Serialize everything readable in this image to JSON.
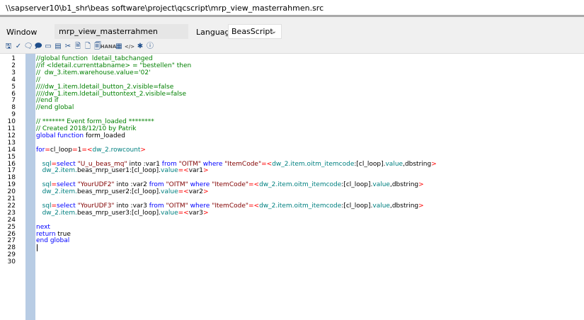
{
  "titlebar": {
    "path": "\\\\sapserver10\\b1_shr\\beas software\\project\\qcscript\\mrp_view_masterrahmen.src"
  },
  "form": {
    "window_label": "Window",
    "window_value": "mrp_view_masterrahmen",
    "language_label": "Language",
    "language_value": "BeasScript"
  },
  "toolbar": [
    {
      "icon": "save-icon",
      "glyph": "🖫"
    },
    {
      "icon": "check-syntax-icon",
      "glyph": "✓"
    },
    {
      "icon": "comment-icon",
      "glyph": "🗨"
    },
    {
      "icon": "uncomment-icon",
      "glyph": "🗩"
    },
    {
      "icon": "message-icon",
      "glyph": "▭"
    },
    {
      "icon": "format-icon",
      "glyph": "▤"
    },
    {
      "icon": "tools-icon",
      "glyph": "✂"
    },
    {
      "icon": "document-icon",
      "glyph": "🗎"
    },
    {
      "icon": "document-alt-icon",
      "glyph": "🗋"
    },
    {
      "icon": "document-list-icon",
      "glyph": "🗐"
    },
    {
      "icon": "hana-icon",
      "glyph": "HANA"
    },
    {
      "icon": "database-icon",
      "glyph": "▦"
    },
    {
      "icon": "code-icon",
      "glyph": "</>"
    },
    {
      "icon": "debug-icon",
      "glyph": "✱"
    },
    {
      "icon": "info-icon",
      "glyph": "ⓘ"
    }
  ],
  "line_numbers": [
    "1",
    "2",
    "3",
    "4",
    "5",
    "6",
    "7",
    "8",
    "9",
    "10",
    "11",
    "12",
    "13",
    "14",
    "15",
    "16",
    "17",
    "18",
    "19",
    "20",
    "21",
    "22",
    "23",
    "24",
    "25",
    "26",
    "27",
    "28",
    "29",
    "30"
  ],
  "code_lines": [
    [
      {
        "c": "cm",
        "t": "//global function  ldetail_tabchanged"
      }
    ],
    [
      {
        "c": "cm",
        "t": "//if <ldetail.currenttabname> = \"bestellen\" then"
      }
    ],
    [
      {
        "c": "cm",
        "t": "//  dw_3.item.warehouse.value='02'"
      }
    ],
    [
      {
        "c": "cm",
        "t": "//"
      }
    ],
    [
      {
        "c": "cm",
        "t": "////dw_1.item.ldetail_button_2.visible=false"
      }
    ],
    [
      {
        "c": "cm",
        "t": "////dw_1.item.ldetail_buttontext_2.visible=false"
      }
    ],
    [
      {
        "c": "cm",
        "t": "//end if"
      }
    ],
    [
      {
        "c": "cm",
        "t": "//end global"
      }
    ],
    [],
    [
      {
        "c": "cm",
        "t": "// ******* Event form_loaded ********"
      }
    ],
    [
      {
        "c": "cm",
        "t": "// Created 2018/12/10 by Patrik"
      }
    ],
    [
      {
        "c": "kw",
        "t": "global function "
      },
      {
        "c": "df",
        "t": "form_loaded"
      }
    ],
    [],
    [
      {
        "c": "kw",
        "t": "for"
      },
      {
        "c": "op",
        "t": "="
      },
      {
        "c": "df",
        "t": "cl_loop"
      },
      {
        "c": "op",
        "t": "="
      },
      {
        "c": "df",
        "t": "1"
      },
      {
        "c": "op",
        "t": "=<"
      },
      {
        "c": "vr",
        "t": "dw_2.rowcount"
      },
      {
        "c": "op",
        "t": ">"
      }
    ],
    [],
    [
      {
        "c": "df",
        "t": "   "
      },
      {
        "c": "vr",
        "t": "sql"
      },
      {
        "c": "op",
        "t": "="
      },
      {
        "c": "kw",
        "t": "select "
      },
      {
        "c": "st",
        "t": "\"U_u_beas_mq\""
      },
      {
        "c": "df",
        "t": " into :var1 "
      },
      {
        "c": "kw",
        "t": "from "
      },
      {
        "c": "st",
        "t": "\"OITM\""
      },
      {
        "c": "df",
        "t": " "
      },
      {
        "c": "kw",
        "t": "where "
      },
      {
        "c": "st",
        "t": "\"ItemCode\""
      },
      {
        "c": "op",
        "t": "=<"
      },
      {
        "c": "vr",
        "t": "dw_2.item.oitm_itemcode"
      },
      {
        "c": "df",
        "t": ":[cl_loop]."
      },
      {
        "c": "vr",
        "t": "value"
      },
      {
        "c": "df",
        "t": ",dbstring"
      },
      {
        "c": "op",
        "t": ">"
      }
    ],
    [
      {
        "c": "df",
        "t": "   "
      },
      {
        "c": "vr",
        "t": "dw_2.item."
      },
      {
        "c": "df",
        "t": "beas_mrp_user1:[cl_loop]."
      },
      {
        "c": "vr",
        "t": "value"
      },
      {
        "c": "op",
        "t": "=<"
      },
      {
        "c": "df",
        "t": "var1"
      },
      {
        "c": "op",
        "t": ">"
      }
    ],
    [],
    [
      {
        "c": "df",
        "t": "   "
      },
      {
        "c": "vr",
        "t": "sql"
      },
      {
        "c": "op",
        "t": "="
      },
      {
        "c": "kw",
        "t": "select "
      },
      {
        "c": "st",
        "t": "\"YourUDF2\""
      },
      {
        "c": "df",
        "t": " into :var2 "
      },
      {
        "c": "kw",
        "t": "from "
      },
      {
        "c": "st",
        "t": "\"OITM\""
      },
      {
        "c": "df",
        "t": " "
      },
      {
        "c": "kw",
        "t": "where "
      },
      {
        "c": "st",
        "t": "\"ItemCode\""
      },
      {
        "c": "op",
        "t": "=<"
      },
      {
        "c": "vr",
        "t": "dw_2.item.oitm_itemcode"
      },
      {
        "c": "df",
        "t": ":[cl_loop]."
      },
      {
        "c": "vr",
        "t": "value"
      },
      {
        "c": "df",
        "t": ",dbstring"
      },
      {
        "c": "op",
        "t": ">"
      }
    ],
    [
      {
        "c": "df",
        "t": "   "
      },
      {
        "c": "vr",
        "t": "dw_2.item."
      },
      {
        "c": "df",
        "t": "beas_mrp_user2:[cl_loop]."
      },
      {
        "c": "vr",
        "t": "value"
      },
      {
        "c": "op",
        "t": "=<"
      },
      {
        "c": "df",
        "t": "var2"
      },
      {
        "c": "op",
        "t": ">"
      }
    ],
    [],
    [
      {
        "c": "df",
        "t": "   "
      },
      {
        "c": "vr",
        "t": "sql"
      },
      {
        "c": "op",
        "t": "="
      },
      {
        "c": "kw",
        "t": "select "
      },
      {
        "c": "st",
        "t": "\"YourUDF3\""
      },
      {
        "c": "df",
        "t": " into :var3 "
      },
      {
        "c": "kw",
        "t": "from "
      },
      {
        "c": "st",
        "t": "\"OITM\""
      },
      {
        "c": "df",
        "t": " "
      },
      {
        "c": "kw",
        "t": "where "
      },
      {
        "c": "st",
        "t": "\"ItemCode\""
      },
      {
        "c": "op",
        "t": "=<"
      },
      {
        "c": "vr",
        "t": "dw_2.item.oitm_itemcode"
      },
      {
        "c": "df",
        "t": ":[cl_loop]."
      },
      {
        "c": "vr",
        "t": "value"
      },
      {
        "c": "df",
        "t": ",dbstring"
      },
      {
        "c": "op",
        "t": ">"
      }
    ],
    [
      {
        "c": "df",
        "t": "   "
      },
      {
        "c": "vr",
        "t": "dw_2.item."
      },
      {
        "c": "df",
        "t": "beas_mrp_user3:[cl_loop]."
      },
      {
        "c": "vr",
        "t": "value"
      },
      {
        "c": "op",
        "t": "=<"
      },
      {
        "c": "df",
        "t": "var3"
      },
      {
        "c": "op",
        "t": ">"
      }
    ],
    [],
    [
      {
        "c": "kw",
        "t": "next"
      }
    ],
    [
      {
        "c": "kw",
        "t": "return "
      },
      {
        "c": "df",
        "t": "true"
      }
    ],
    [
      {
        "c": "kw",
        "t": "end global"
      }
    ],
    [],
    [],
    []
  ],
  "colors": {
    "fold_margin": "#b8cce4",
    "comment": "#008000",
    "keyword": "#0000ff",
    "string": "#800000"
  }
}
